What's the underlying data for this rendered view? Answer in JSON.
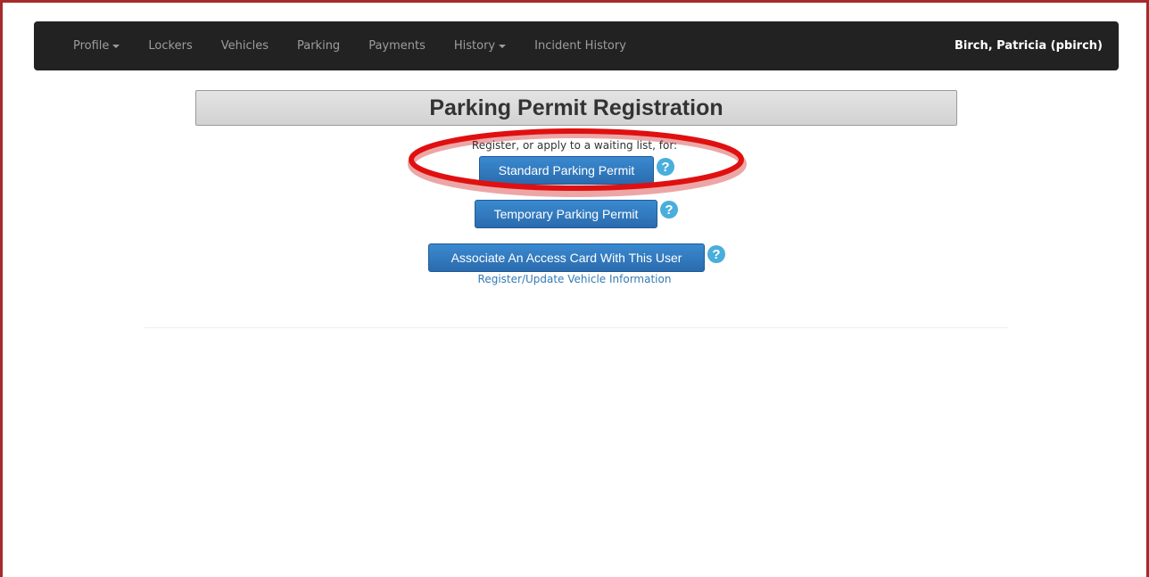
{
  "navbar": {
    "items": [
      {
        "label": "Profile",
        "dropdown": true
      },
      {
        "label": "Lockers",
        "dropdown": false
      },
      {
        "label": "Vehicles",
        "dropdown": false
      },
      {
        "label": "Parking",
        "dropdown": false
      },
      {
        "label": "Payments",
        "dropdown": false
      },
      {
        "label": "History",
        "dropdown": true
      },
      {
        "label": "Incident History",
        "dropdown": false
      }
    ],
    "user": "Birch, Patricia (pbirch)"
  },
  "main": {
    "title": "Parking Permit Registration",
    "subtitle": "Register, or apply to a waiting list, for:",
    "buttons": {
      "standard": "Standard Parking Permit",
      "temporary": "Temporary Parking Permit",
      "access_card": "Associate An Access Card With This User"
    },
    "help_glyph": "?",
    "vehicle_link": "Register/Update Vehicle Information"
  },
  "colors": {
    "navbar_bg": "#222222",
    "button_blue": "#2f7ac0",
    "help_blue": "#4aaedc",
    "highlight_red": "#e01010",
    "frame": "#a52a2a"
  },
  "icons": {
    "help": "question-circle-icon",
    "caret": "caret-down-icon"
  }
}
